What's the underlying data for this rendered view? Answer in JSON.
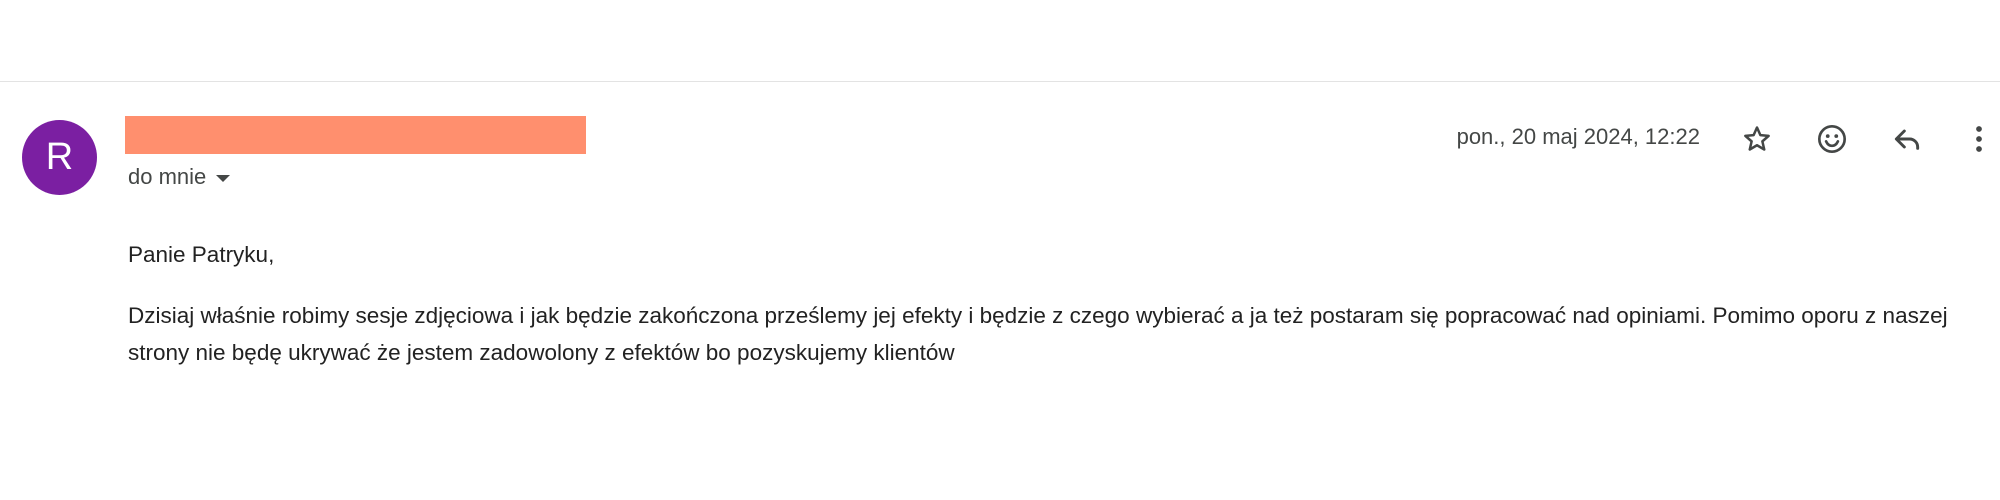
{
  "sender": {
    "avatar_letter": "R",
    "avatar_color": "#7b1fa2",
    "name_redaction_color": "#ff8f6e",
    "recipient_label": "do mnie"
  },
  "header": {
    "timestamp": "pon., 20 maj 2024, 12:22",
    "icons": [
      "star-icon",
      "emoji-icon",
      "reply-icon",
      "more-vert-icon"
    ]
  },
  "message": {
    "greeting": "Panie Patryku,",
    "paragraph": "Dzisiaj właśnie robimy sesje zdjęciowa i jak będzie zakończona prześlemy jej efekty i będzie z czego wybierać a ja też postaram się popracować nad opiniami. Pomimo oporu z naszej strony nie będę ukrywać że jestem zadowolony z efektów bo pozyskujemy klientów"
  }
}
